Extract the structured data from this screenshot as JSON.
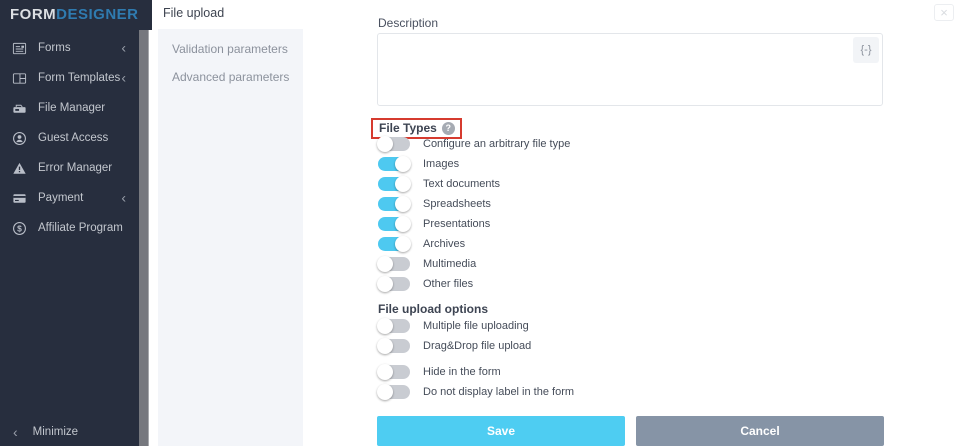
{
  "sidebar": {
    "logo": {
      "part1": "FORM",
      "part2": "DESIGNER"
    },
    "items": [
      {
        "label": "Forms",
        "icon": "forms-icon",
        "has_submenu": true
      },
      {
        "label": "Form Templates",
        "icon": "form-templates-icon",
        "has_submenu": true
      },
      {
        "label": "File Manager",
        "icon": "file-manager-icon",
        "has_submenu": false
      },
      {
        "label": "Guest Access",
        "icon": "guest-access-icon",
        "has_submenu": false
      },
      {
        "label": "Error Manager",
        "icon": "warning-icon",
        "has_submenu": false
      },
      {
        "label": "Payment",
        "icon": "payment-icon",
        "has_submenu": true
      },
      {
        "label": "Affiliate Program",
        "icon": "dollar-icon",
        "has_submenu": false
      }
    ],
    "chevron": "‹",
    "minimize": {
      "label": "Minimize",
      "chevron": "‹"
    }
  },
  "panel": {
    "title": "File upload",
    "nav": [
      {
        "label": "Validation parameters"
      },
      {
        "label": "Advanced parameters"
      }
    ]
  },
  "main": {
    "close_glyph": "×",
    "description": {
      "label": "Description",
      "value": "",
      "insert_glyph": "{-}"
    },
    "file_types": {
      "label": "File Types",
      "help_glyph": "?",
      "toggles": [
        {
          "label": "Configure an arbitrary file type",
          "on": false
        },
        {
          "label": "Images",
          "on": true
        },
        {
          "label": "Text documents",
          "on": true
        },
        {
          "label": "Spreadsheets",
          "on": true
        },
        {
          "label": "Presentations",
          "on": true
        },
        {
          "label": "Archives",
          "on": true
        },
        {
          "label": "Multimedia",
          "on": false
        },
        {
          "label": "Other files",
          "on": false
        }
      ]
    },
    "upload_options": {
      "label": "File upload options",
      "toggles": [
        {
          "label": "Multiple file uploading",
          "on": false
        },
        {
          "label": "Drag&Drop file upload",
          "on": false
        }
      ]
    },
    "misc_options": {
      "toggles": [
        {
          "label": "Hide in the form",
          "on": false
        },
        {
          "label": "Do not display label in the form",
          "on": false
        }
      ]
    },
    "buttons": {
      "save": "Save",
      "cancel": "Cancel"
    }
  },
  "colors": {
    "sidebar_bg": "#272e3e",
    "accent_cyan": "#4ec9f0",
    "save_button": "#4ecdf2",
    "cancel_button": "#8694a6",
    "highlight_red": "#d63b2f",
    "panel_nav_bg": "#f3f5f9"
  }
}
